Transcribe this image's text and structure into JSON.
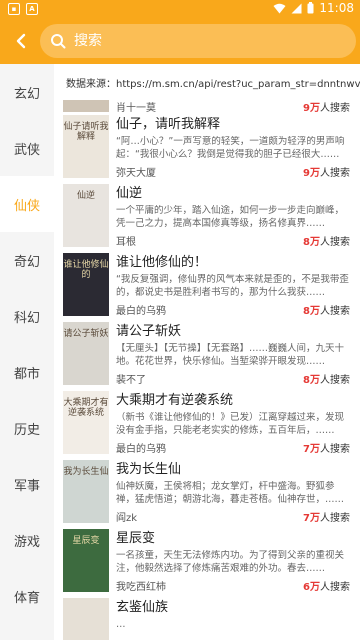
{
  "status": {
    "time": "11:08"
  },
  "appbar": {
    "search_placeholder": "搜索"
  },
  "sidebar": {
    "items": [
      "玄幻",
      "武侠",
      "仙侠",
      "奇幻",
      "科幻",
      "都市",
      "历史",
      "军事",
      "游戏",
      "体育"
    ],
    "active": "仙侠"
  },
  "source_line": "数据来源：https://m.sm.cn/api/rest?uc_param_str=dnntnwve...",
  "top_partial": {
    "author": "肖十一莫",
    "heat_num": "9万",
    "heat_suffix": "人搜索"
  },
  "books": [
    {
      "title": "仙子，请听我解释",
      "desc": "“阿…小心？”一声写意的轻笑，一道颇为轻浮的男声响起：“我很小心么？我倒是觉得我的胆子已经很大……",
      "author": "弥天大厦",
      "heat_num": "9万",
      "heat_suffix": "人搜索",
      "cover_text": "仙子请听我解释",
      "cover_bg": "#ece6dc"
    },
    {
      "title": "仙逆",
      "desc": "一个平庸的少年，踏入仙途，如何一步一步走向巅峰，凭一己之力，提高本国修真等级，扬名修真界……",
      "author": "耳根",
      "heat_num": "8万",
      "heat_suffix": "人搜索",
      "cover_text": "仙逆",
      "cover_bg": "#e8e4df"
    },
    {
      "title": "谁让他修仙的！",
      "desc": "“我反复强调，修仙界的风气本来就是歪的，不是我带歪的，都说史书是胜利者书写的，那为什么我获……",
      "author": "最白的乌鸦",
      "heat_num": "8万",
      "heat_suffix": "人搜索",
      "cover_text": "谁让他修仙的",
      "cover_bg": "#2b2a33"
    },
    {
      "title": "请公子斩妖",
      "desc": "【无厘头】【无节操】【无套路】……巍巍人间，九天十地。花花世界，快乐修仙。当堑梁骅开眼发现……",
      "author": "裴不了",
      "heat_num": "8万",
      "heat_suffix": "人搜索",
      "cover_text": "请公子斩妖",
      "cover_bg": "#d9d6cf"
    },
    {
      "title": "大乘期才有逆袭系统",
      "desc": "（新书《谁让他修仙的！》已发）江离穿越过来，发现没有金手指，只能老老实实的修炼，五百年后，……",
      "author": "最白的乌鸦",
      "heat_num": "7万",
      "heat_suffix": "人搜索",
      "cover_text": "大乘期才有逆袭系统",
      "cover_bg": "#f2ede6"
    },
    {
      "title": "我为长生仙",
      "desc": "仙神妖魔，王侯将相；龙女掌灯，杆中盛海。野狐参禅，猛虎悟道；朝游北海，暮走苍梧。仙神存世，……",
      "author": "阎zk",
      "heat_num": "7万",
      "heat_suffix": "人搜索",
      "cover_text": "我为长生仙",
      "cover_bg": "#cfd6d2"
    },
    {
      "title": "星辰变",
      "desc": "一名孩童，天生无法修炼内功。为了得到父亲的重视关注，他毅然选择了修炼痛苦艰难的外功。春去……",
      "author": "我吃西红柿",
      "heat_num": "6万",
      "heat_suffix": "人搜索",
      "cover_text": "星辰变",
      "cover_bg": "#3d6b3f"
    },
    {
      "title": "玄鉴仙族",
      "desc": "…",
      "author": "",
      "heat_num": "",
      "heat_suffix": "",
      "cover_text": "",
      "cover_bg": "#e6e0d6"
    }
  ]
}
